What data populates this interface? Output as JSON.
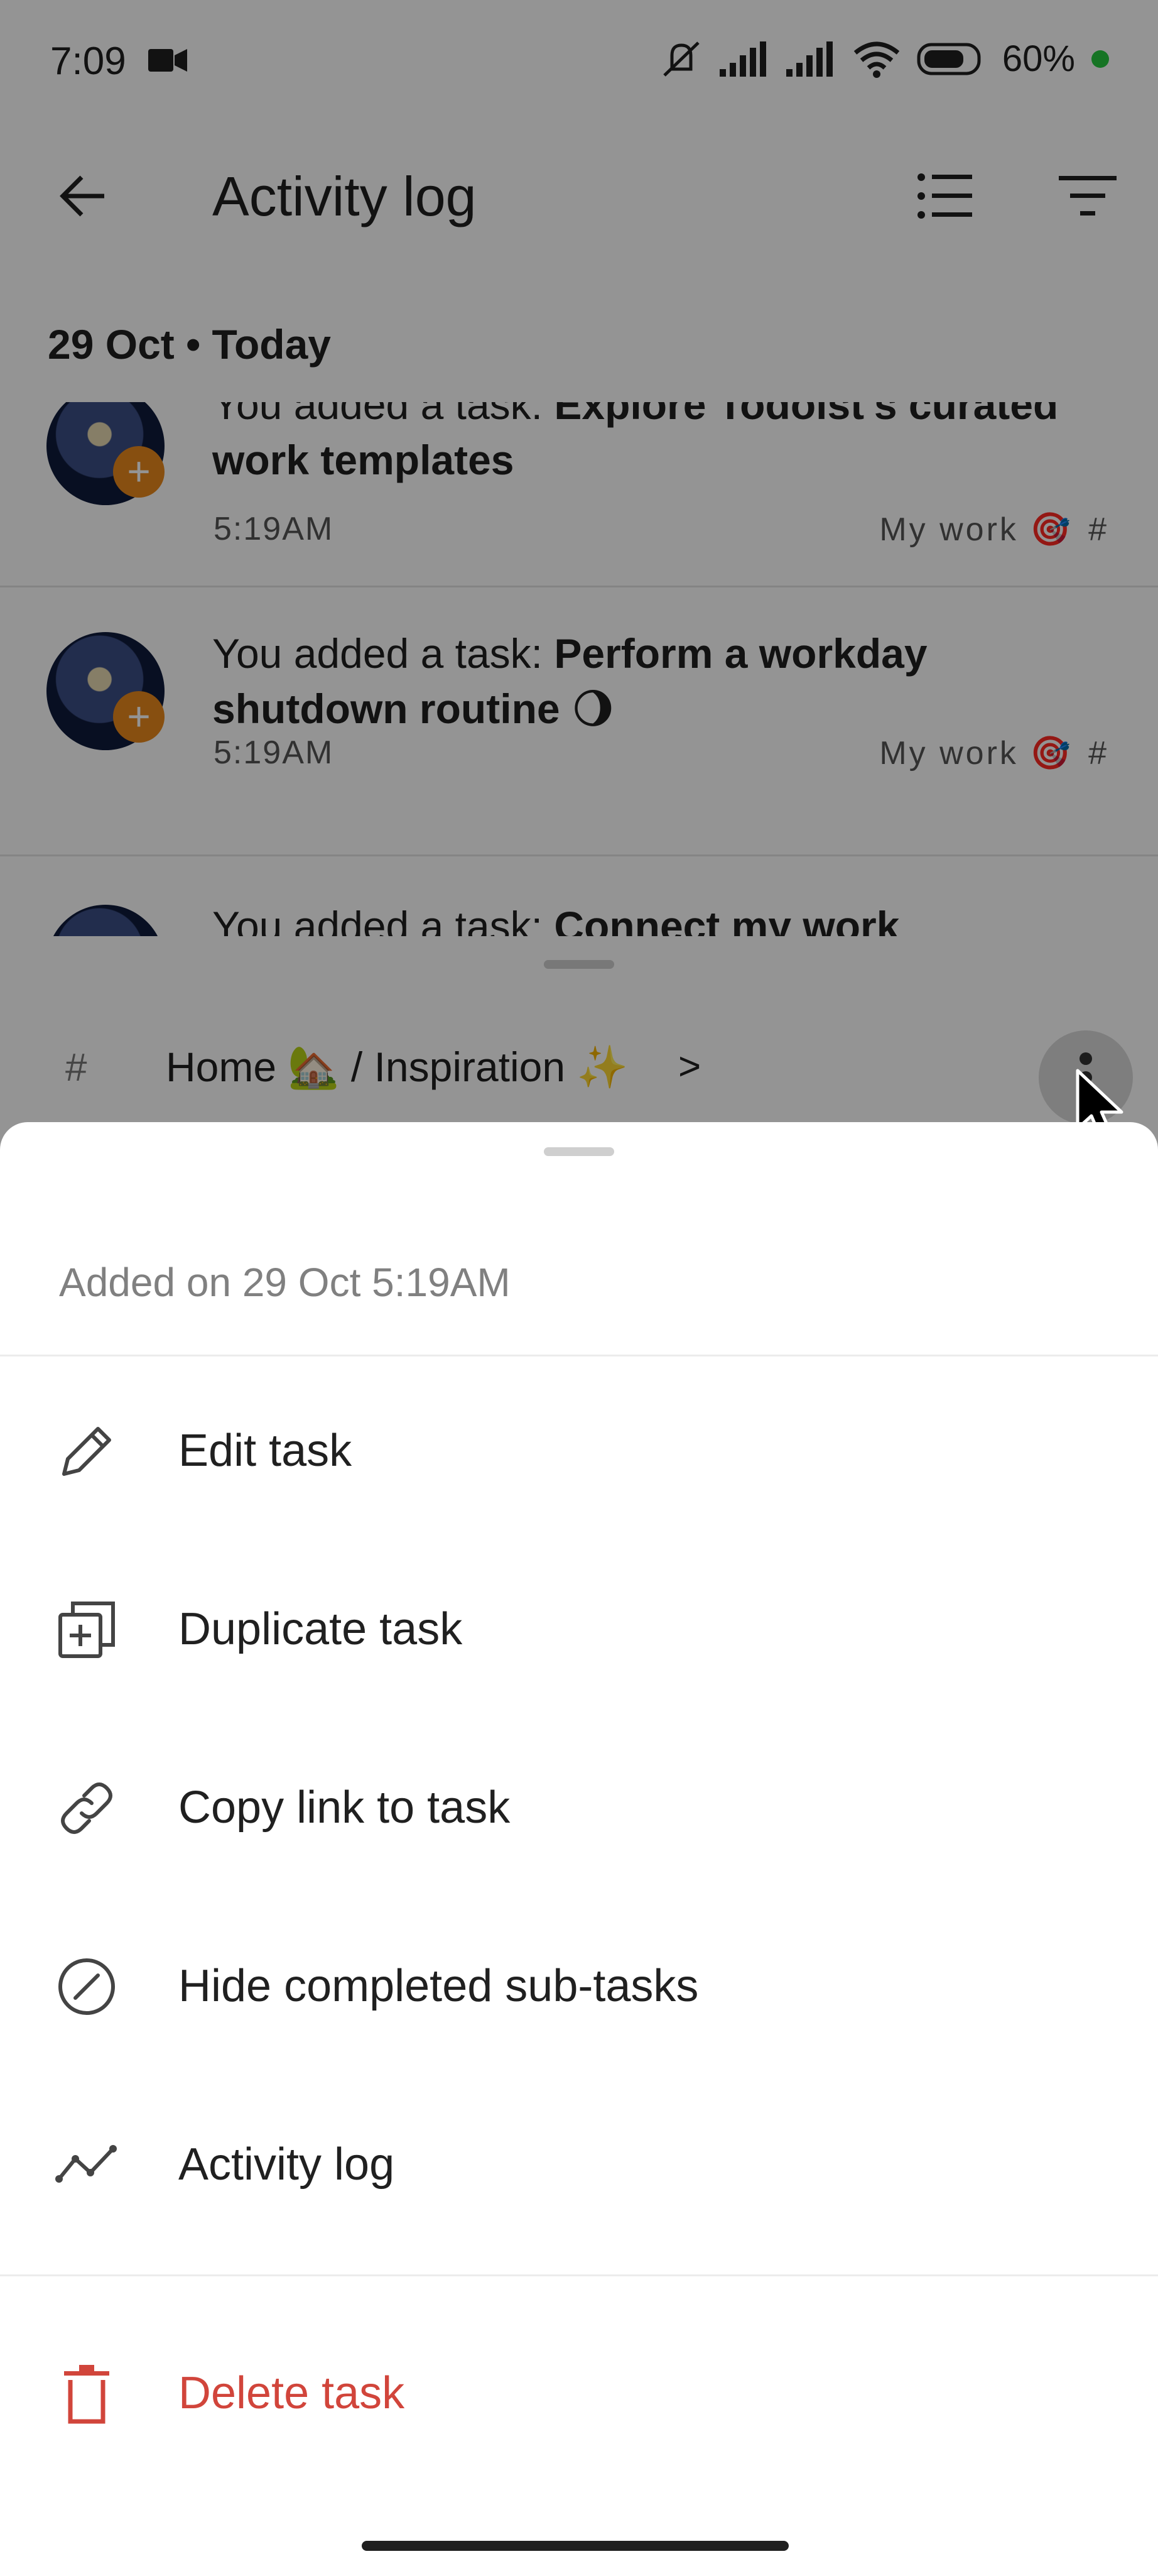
{
  "status_bar": {
    "time": "7:09",
    "battery": "60%",
    "icons": [
      "video-camera-icon",
      "mute-icon",
      "signal-icon",
      "signal-icon",
      "wifi-icon",
      "battery-icon"
    ],
    "battery_dot_color": "#27c93f"
  },
  "header": {
    "title": "Activity log",
    "back_icon": "arrow-left-icon",
    "actions": [
      "list-view-icon",
      "filter-icon"
    ]
  },
  "activity": {
    "date_header": "29 Oct • Today",
    "entries": [
      {
        "prefix": "You added a task: ",
        "task": "Explore Todoist's curated work templates",
        "time": "5:19AM",
        "project": "My work 🎯",
        "hash": "#"
      },
      {
        "prefix": "You added a task: ",
        "task": "Perform a workday shutdown routine 🌖",
        "time": "5:19AM",
        "project": "My work 🎯",
        "hash": "#"
      },
      {
        "prefix": "You added a task: ",
        "task": "Connect my work",
        "time": "",
        "project": "",
        "hash": ""
      }
    ]
  },
  "task_sheet": {
    "hash": "#",
    "breadcrumb": "Home 🏡 / Inspiration ✨",
    "chevron": ">"
  },
  "menu": {
    "added_on": "Added on 29 Oct 5:19AM",
    "items": [
      {
        "label": "Edit task",
        "icon": "pencil-icon"
      },
      {
        "label": "Duplicate task",
        "icon": "duplicate-icon"
      },
      {
        "label": "Copy link to task",
        "icon": "link-icon"
      },
      {
        "label": "Hide completed sub-tasks",
        "icon": "hide-icon"
      },
      {
        "label": "Activity log",
        "icon": "activity-icon"
      }
    ],
    "danger_item": {
      "label": "Delete task",
      "icon": "trash-icon",
      "color": "#d1453b"
    }
  }
}
